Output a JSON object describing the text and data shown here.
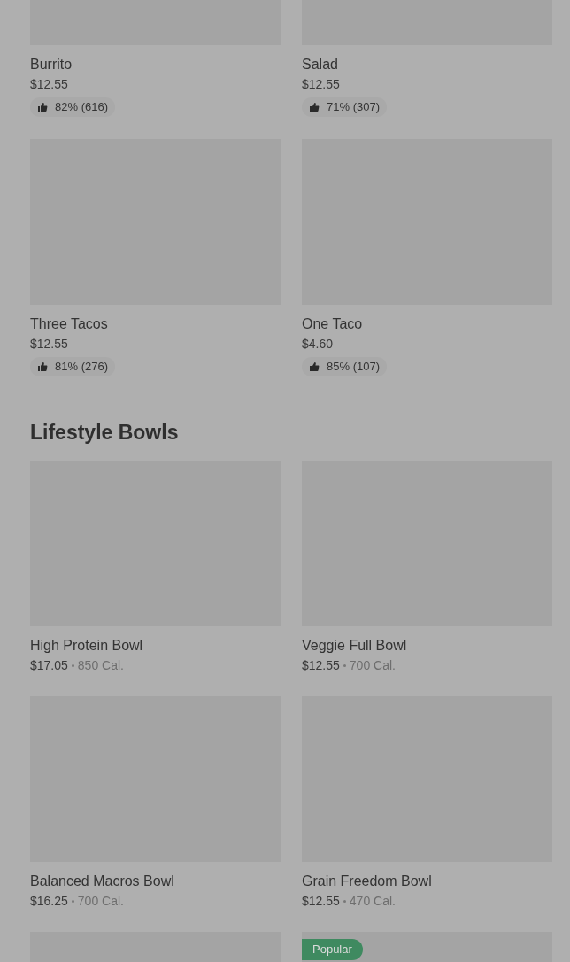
{
  "sections": [
    {
      "items": [
        {
          "kind": "rated",
          "name": "Burrito",
          "price": "$12.55",
          "rating": "82% (616)"
        },
        {
          "kind": "rated",
          "name": "Salad",
          "price": "$12.55",
          "rating": "71% (307)"
        },
        {
          "kind": "rated",
          "name": "Three Tacos",
          "price": "$12.55",
          "rating": "81% (276)"
        },
        {
          "kind": "rated",
          "name": "One Taco",
          "price": "$4.60",
          "rating": "85% (107)"
        }
      ]
    },
    {
      "title": "Lifestyle Bowls",
      "items": [
        {
          "kind": "calories",
          "name": "High Protein Bowl",
          "price": "$17.05",
          "calories": "850 Cal."
        },
        {
          "kind": "calories",
          "name": "Veggie Full Bowl",
          "price": "$12.55",
          "calories": "700 Cal."
        },
        {
          "kind": "calories",
          "name": "Balanced Macros Bowl",
          "price": "$16.25",
          "calories": "700 Cal."
        },
        {
          "kind": "calories",
          "name": "Grain Freedom Bowl",
          "price": "$12.55",
          "calories": "470 Cal."
        },
        {
          "kind": "image_only"
        },
        {
          "kind": "image_only",
          "badge": "Popular"
        }
      ]
    }
  ]
}
